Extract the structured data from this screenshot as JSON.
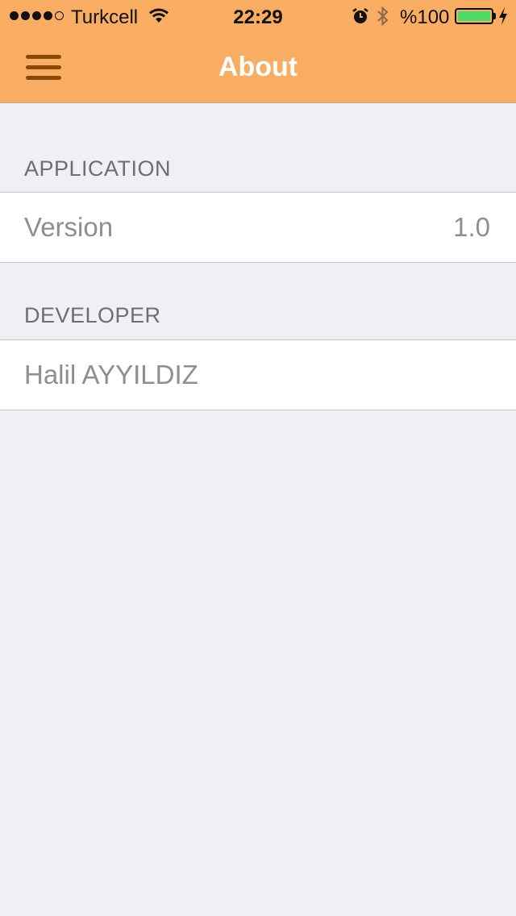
{
  "status_bar": {
    "carrier": "Turkcell",
    "time": "22:29",
    "battery_text": "%100"
  },
  "nav": {
    "title": "About",
    "menu_icon": "hamburger-menu-icon"
  },
  "sections": [
    {
      "header": "APPLICATION",
      "rows": [
        {
          "label": "Version",
          "value": "1.0"
        }
      ]
    },
    {
      "header": "DEVELOPER",
      "rows": [
        {
          "label": "Halil AYYILDIZ"
        }
      ]
    }
  ],
  "colors": {
    "nav_background": "#f9ad62",
    "menu_icon": "#8a4a06",
    "page_background": "#efeff4",
    "battery_fill": "#4cd964"
  }
}
